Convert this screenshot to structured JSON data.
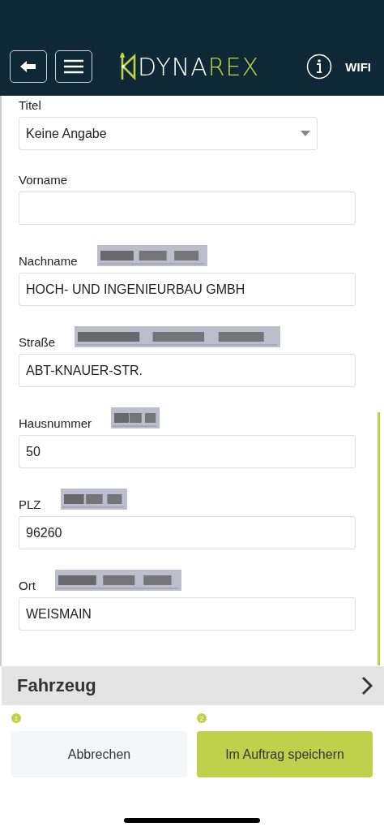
{
  "header": {
    "logo_left": "DYNA",
    "logo_right": "REX",
    "network": "WIFI"
  },
  "form": {
    "fields": [
      {
        "kind": "select",
        "label": "Titel",
        "value": "Keine Angabe"
      },
      {
        "kind": "input",
        "label": "Vorname"
      },
      {
        "kind": "input",
        "label": "Nachname",
        "value": "HOCH- UND INGENIEURBAU GMBH"
      },
      {
        "kind": "input",
        "label": "Straße",
        "value": "ABT-KNAUER-STR."
      },
      {
        "kind": "input",
        "label": "Hausnummer",
        "value": "50"
      },
      {
        "kind": "input",
        "label": "PLZ",
        "value": "96260"
      },
      {
        "kind": "input",
        "label": "Ort",
        "value": "WEISMAIN"
      }
    ]
  },
  "section": {
    "title": "Fahrzeug",
    "expanded": false
  },
  "buttons": [
    {
      "kind": "secondary",
      "badge": "1",
      "label": "Abbrechen"
    },
    {
      "kind": "primary",
      "badge": "2",
      "label": "Im Auftrag speichern"
    }
  ]
}
